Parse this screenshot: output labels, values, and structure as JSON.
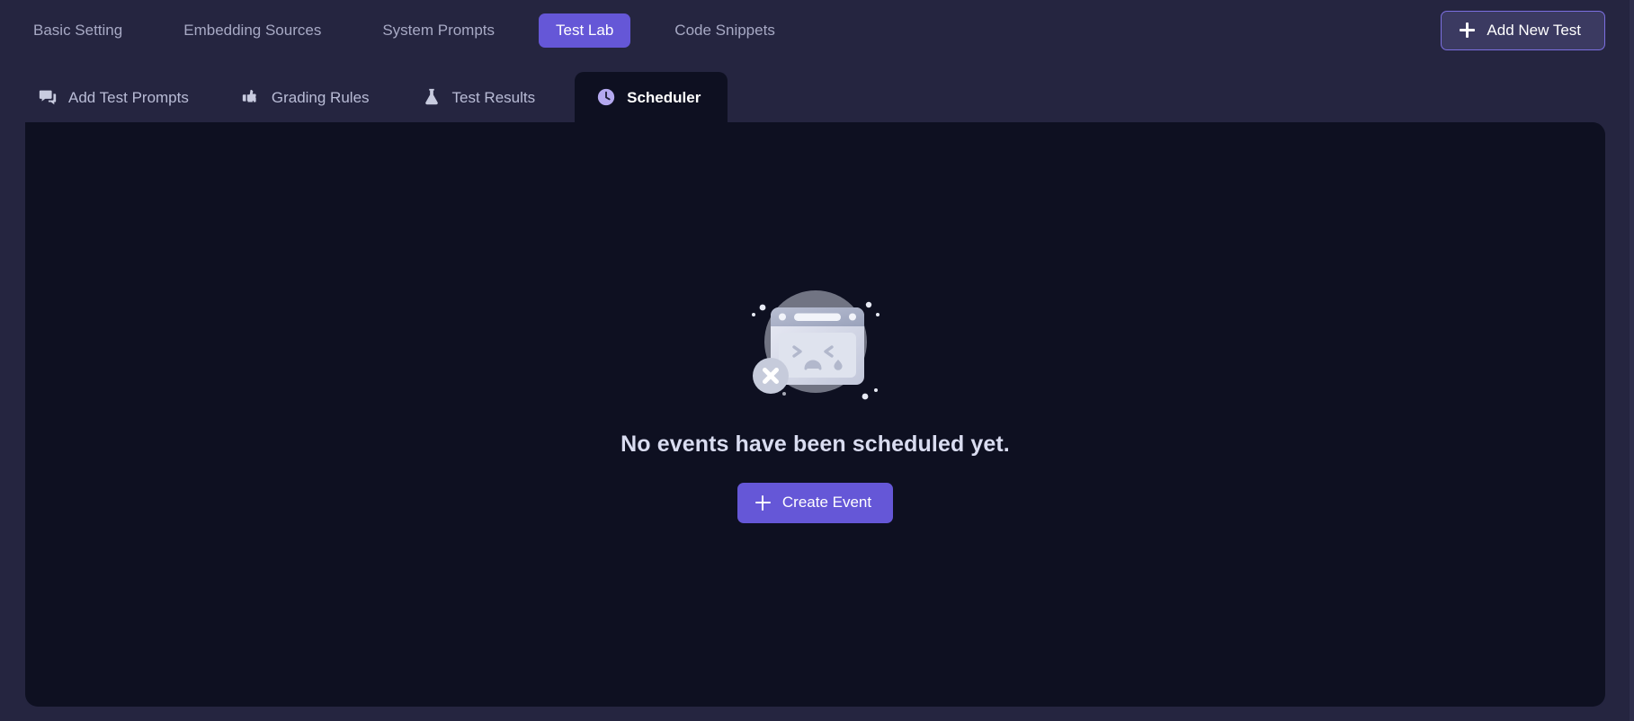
{
  "top_nav": {
    "tabs": [
      {
        "label": "Basic Setting",
        "active": false
      },
      {
        "label": "Embedding Sources",
        "active": false
      },
      {
        "label": "System Prompts",
        "active": false
      },
      {
        "label": "Test Lab",
        "active": true
      },
      {
        "label": "Code Snippets",
        "active": false
      }
    ],
    "add_new_test_label": "Add New Test",
    "add_new_test_icon": "plus-icon"
  },
  "sub_nav": {
    "tabs": [
      {
        "label": "Add Test Prompts",
        "icon": "chat-bubbles-icon",
        "active": false
      },
      {
        "label": "Grading Rules",
        "icon": "thumbs-up-down-icon",
        "active": false
      },
      {
        "label": "Test Results",
        "icon": "flask-icon",
        "active": false
      },
      {
        "label": "Scheduler",
        "icon": "clock-icon",
        "active": true
      }
    ]
  },
  "empty_state": {
    "illustration": "sad-browser-window-error-icon",
    "title": "No events have been scheduled yet.",
    "create_button_label": "Create Event",
    "create_button_icon": "plus-icon"
  },
  "colors": {
    "page_background": "#252540",
    "panel_background": "#0e1021",
    "accent_purple": "#6557d7",
    "accent_purple_light": "#b4a9f0",
    "muted_text": "#a7a9c4",
    "title_text": "#d9dcf0",
    "outline_button_fill": "#3b3a61",
    "outline_button_border": "#7b6fe0"
  }
}
